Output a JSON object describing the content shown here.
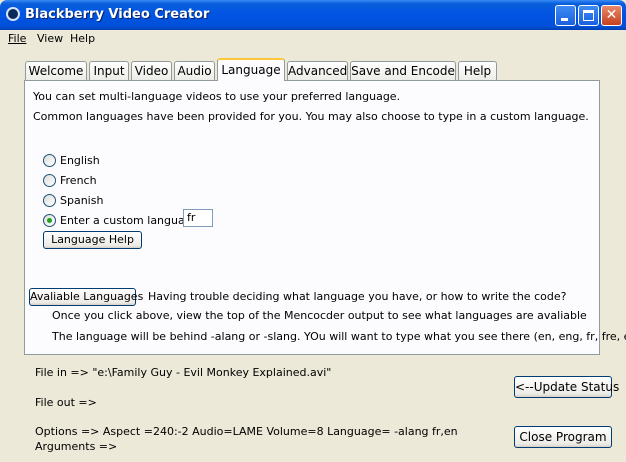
{
  "window": {
    "title": "Blackberry Video Creator"
  },
  "menu": {
    "file": "File",
    "view": "View",
    "help": "Help"
  },
  "tabs": [
    "Welcome",
    "Input",
    "Video",
    "Audio",
    "Language",
    "Advanced",
    "Save and Encode",
    "Help"
  ],
  "active_tab": "Language",
  "language": {
    "intro1": "You can set multi-language videos to use your preferred language.",
    "intro2": "Common languages have been provided for you.  You may also choose to type in a custom language.",
    "options": [
      "English",
      "French",
      "Spanish",
      "Enter a custom language"
    ],
    "selected": "Enter a custom language",
    "custom_value": "fr",
    "help_button": "Language Help",
    "available_button": "Avaliable Languages",
    "trouble_text": "Having trouble deciding what language you have, or how to write the code?",
    "info1": "Once you click above, view the top of the Mencocder output to see what languages are avaliable",
    "info2": "The language will be behind -alang or -slang.  YOu will want to type what you see there (en, eng, fr, fre, etc)"
  },
  "status": {
    "file_in": "File in =>  \"e:\\Family Guy - Evil Monkey Explained.avi\"",
    "file_out": "File out =>",
    "options": "Options =>  Aspect =240:-2   Audio=LAME   Volume=8    Language= -alang fr,en",
    "arguments": "Arguments =>"
  },
  "buttons": {
    "update_status": "<--Update Status",
    "close_program": "Close Program"
  }
}
